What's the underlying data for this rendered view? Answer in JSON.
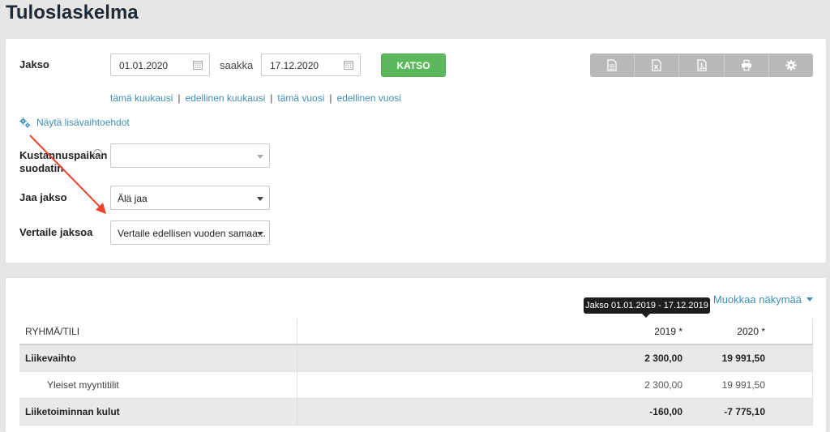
{
  "page": {
    "title": "Tuloslaskelma"
  },
  "period": {
    "label": "Jakso",
    "from": "01.01.2020",
    "to_label": "saakka",
    "to": "17.12.2020",
    "view_button": "KATSO"
  },
  "toolbar": {
    "icons": [
      "document-icon",
      "excel-icon",
      "pdf-icon",
      "print-icon",
      "gear-icon"
    ]
  },
  "quick_links": [
    "tämä kuukausi",
    "edellinen kuukausi",
    "tämä vuosi",
    "edellinen vuosi"
  ],
  "quick_link_separator": "|",
  "more_options": "Näytä lisävaihtoehdot",
  "filters": {
    "cost_center_label_1": "Kustannuspaikan",
    "cost_center_label_2": "suodatin",
    "cost_center_value": "",
    "split_label": "Jaa jakso",
    "split_value": "Älä jaa",
    "compare_label": "Vertaile jaksoa",
    "compare_value": "Vertaile edellisen vuoden samaa..."
  },
  "report": {
    "edit_view": "Muokkaa näkymää",
    "tooltip": "Jakso 01.01.2019 - 17.12.2019",
    "columns": [
      "RYHMÄ/TILI",
      "2019 *",
      "2020 *"
    ],
    "rows": [
      {
        "name": "Liikevaihto",
        "v2019": "2 300,00",
        "v2020": "19 991,50"
      },
      {
        "name": "Yleiset myyntitilit",
        "v2019": "2 300,00",
        "v2020": "19 991,50"
      },
      {
        "name": "Liiketoiminnan kulut",
        "v2019": "-160,00",
        "v2020": "-7 775,10"
      }
    ]
  },
  "colors": {
    "accent": "#3f8fb6",
    "button_green": "#5cb85c",
    "annotation_arrow": "#e8452c"
  }
}
